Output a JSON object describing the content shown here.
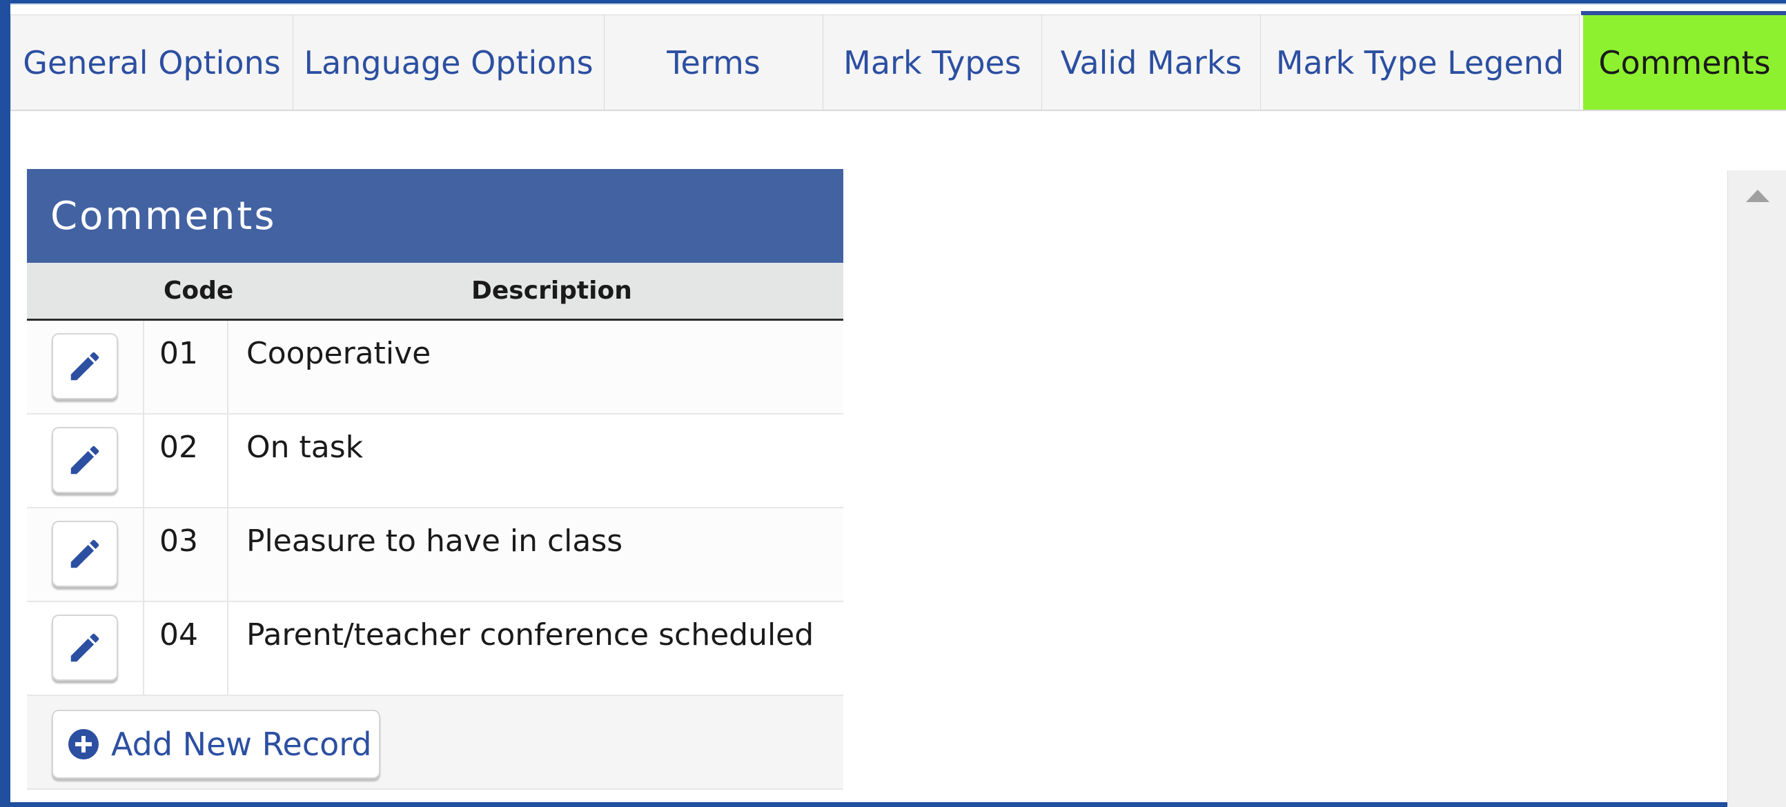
{
  "tabs": [
    {
      "label": "General Options",
      "active": false
    },
    {
      "label": "Language Options",
      "active": false
    },
    {
      "label": "Terms",
      "active": false
    },
    {
      "label": "Mark Types",
      "active": false
    },
    {
      "label": "Valid Marks",
      "active": false
    },
    {
      "label": "Mark Type Legend",
      "active": false
    },
    {
      "label": "Comments",
      "active": true
    }
  ],
  "panel": {
    "title": "Comments",
    "columns": {
      "code": "Code",
      "description": "Description"
    },
    "rows": [
      {
        "code": "01",
        "description": "Cooperative"
      },
      {
        "code": "02",
        "description": "On task"
      },
      {
        "code": "03",
        "description": "Pleasure to have in class"
      },
      {
        "code": "04",
        "description": "Parent/teacher conference scheduled"
      }
    ],
    "add_button_label": "Add New Record",
    "row_action_icon": "pencil-icon",
    "add_icon": "plus-circle-icon"
  },
  "colors": {
    "window_border": "#1f4f9e",
    "tab_text": "#2c4fa1",
    "active_tab_bg": "#8ef12f",
    "panel_header_bg": "#4262a2"
  }
}
